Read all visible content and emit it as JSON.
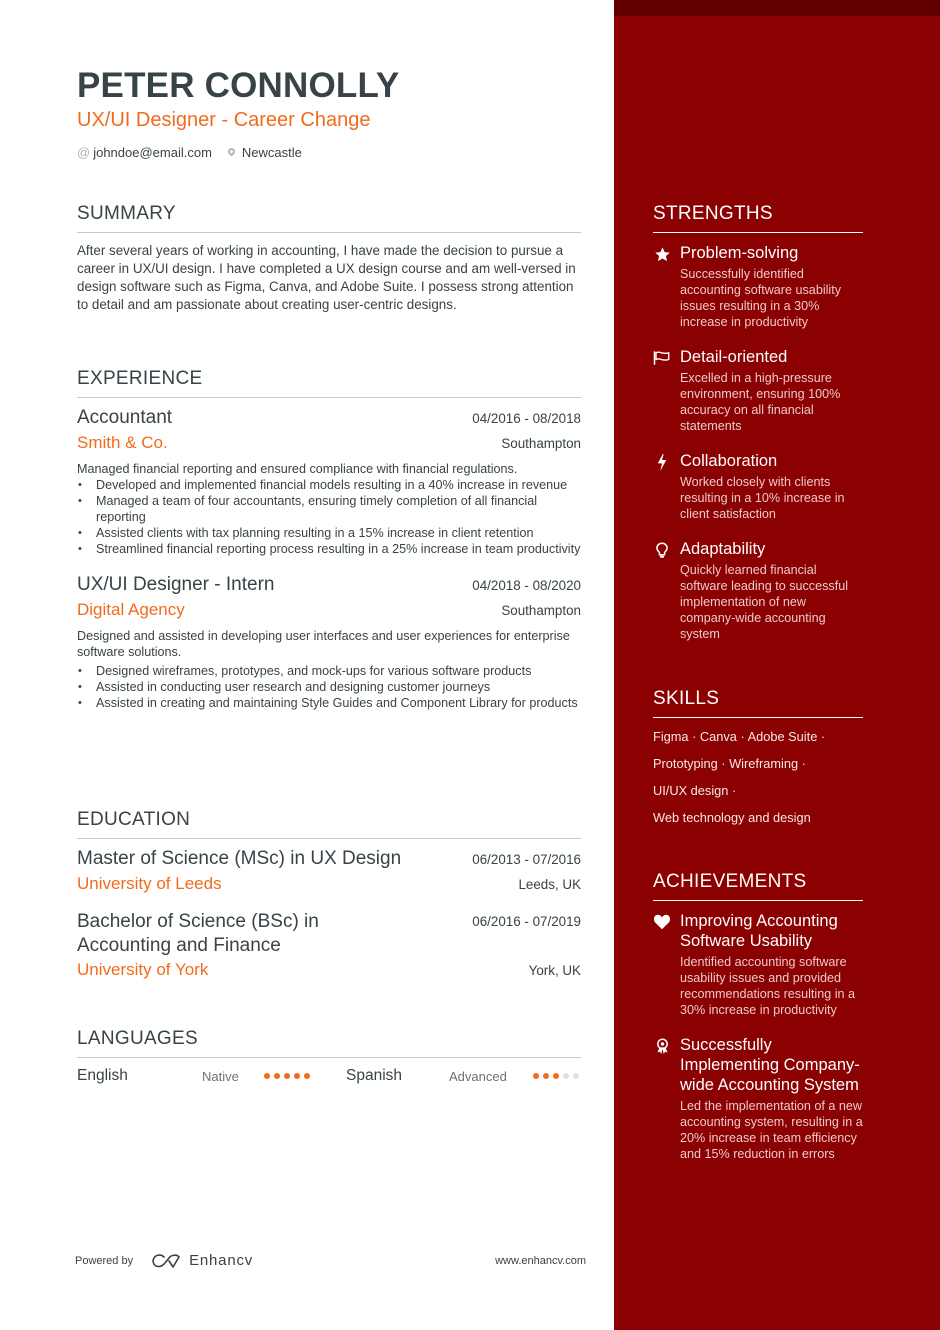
{
  "header": {
    "name": "PETER CONNOLLY",
    "headline": "UX/UI Designer - Career Change",
    "email_icon": "at-icon",
    "email": "johndoe@email.com",
    "location_icon": "map-pin-icon",
    "location": "Newcastle"
  },
  "summary": {
    "title": "SUMMARY",
    "text": "After several years of working in accounting, I have made the decision to pursue a career in UX/UI design. I have completed a UX design course and am well-versed in design software such as Figma, Canva, and Adobe Suite. I possess strong attention to detail and am passionate about creating user-centric designs."
  },
  "experience": {
    "title": "EXPERIENCE",
    "jobs": [
      {
        "title": "Accountant",
        "dates": "04/2016 - 08/2018",
        "company": "Smith & Co.",
        "location": "Southampton",
        "description": "Managed financial reporting and ensured compliance with financial regulations.",
        "bullets": [
          "Developed and implemented financial models resulting in a 40% increase in revenue",
          "Managed a team of four accountants, ensuring timely completion of all financial reporting",
          "Assisted clients with tax planning resulting in a 15% increase in client retention",
          "Streamlined financial reporting process resulting in a 25% increase in team productivity"
        ]
      },
      {
        "title": "UX/UI Designer - Intern",
        "dates": "04/2018 - 08/2020",
        "company": "Digital Agency",
        "location": "Southampton",
        "description": "Designed and assisted in developing user interfaces and user experiences for enterprise software solutions.",
        "bullets": [
          "Designed wireframes, prototypes, and mock-ups for various software products",
          "Assisted in conducting user research and designing customer journeys",
          "Assisted in creating and maintaining Style Guides and Component Library for products"
        ]
      }
    ]
  },
  "education": {
    "title": "EDUCATION",
    "items": [
      {
        "degree": "Master of Science (MSc) in UX Design",
        "dates": "06/2013 - 07/2016",
        "school": "University of Leeds",
        "location": "Leeds, UK"
      },
      {
        "degree": "Bachelor of Science (BSc) in Accounting and Finance",
        "dates": "06/2016 - 07/2019",
        "school": "University of York",
        "location": "York, UK"
      }
    ]
  },
  "languages": {
    "title": "LANGUAGES",
    "items": [
      {
        "name": "English",
        "level": "Native",
        "rating": 5,
        "max": 5
      },
      {
        "name": "Spanish",
        "level": "Advanced",
        "rating": 3,
        "max": 5
      }
    ]
  },
  "footer": {
    "powered_by": "Powered by",
    "brand": "Enhancv",
    "url": "www.enhancv.com"
  },
  "strengths": {
    "title": "STRENGTHS",
    "items": [
      {
        "icon": "star-icon",
        "title": "Problem-solving",
        "description": "Successfully identified accounting software usability issues resulting in a 30% increase in productivity"
      },
      {
        "icon": "flag-icon",
        "title": "Detail-oriented",
        "description": "Excelled in a high-pressure environment, ensuring 100% accuracy on all financial statements"
      },
      {
        "icon": "lightning-icon",
        "title": "Collaboration",
        "description": "Worked closely with clients resulting in a 10% increase in client satisfaction"
      },
      {
        "icon": "lightbulb-icon",
        "title": "Adaptability",
        "description": "Quickly learned financial software leading to successful implementation of new company-wide accounting system"
      }
    ]
  },
  "skills": {
    "title": "SKILLS",
    "lines": [
      "Figma · Canva · Adobe Suite ·",
      "Prototyping · Wireframing ·",
      "UI/UX design ·",
      "Web technology and design"
    ]
  },
  "achievements": {
    "title": "ACHIEVEMENTS",
    "items": [
      {
        "icon": "heart-icon",
        "title": "Improving Accounting Software Usability",
        "description": "Identified accounting software usability issues and provided recommendations resulting in a 30% increase in productivity"
      },
      {
        "icon": "award-medal-icon",
        "title": "Successfully Implementing Company-wide Accounting System",
        "description": "Led the implementation of a new accounting system, resulting in a 20% increase in team efficiency and 15% reduction in errors"
      }
    ]
  },
  "colors": {
    "accent": "#f26b1d",
    "sidebar": "#8b0000",
    "sidebar_top": "#620000",
    "text": "#384347"
  }
}
